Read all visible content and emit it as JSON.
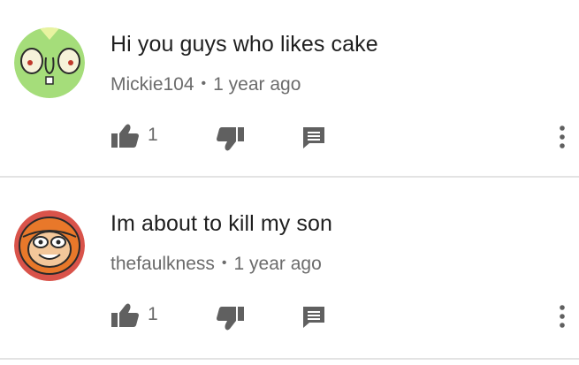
{
  "comments": [
    {
      "text": "Hi you guys who likes cake",
      "author": "Mickie104",
      "separator": "•",
      "time": "1 year ago",
      "like_count": "1",
      "avatar_icon": "green-cartoon-face-avatar-icon"
    },
    {
      "text": "Im about to kill my son",
      "author": "thefaulkness",
      "separator": "•",
      "time": "1 year ago",
      "like_count": "1",
      "avatar_icon": "orange-hooded-cartoon-avatar-icon"
    }
  ],
  "icons": {
    "like": "thumbs-up-icon",
    "dislike": "thumbs-down-icon",
    "reply": "reply-comment-icon",
    "more": "more-vertical-icon"
  },
  "colors": {
    "text": "#1f1f1f",
    "secondary": "#6b6b6b",
    "icon": "#606060",
    "divider": "#e3e3e3"
  }
}
